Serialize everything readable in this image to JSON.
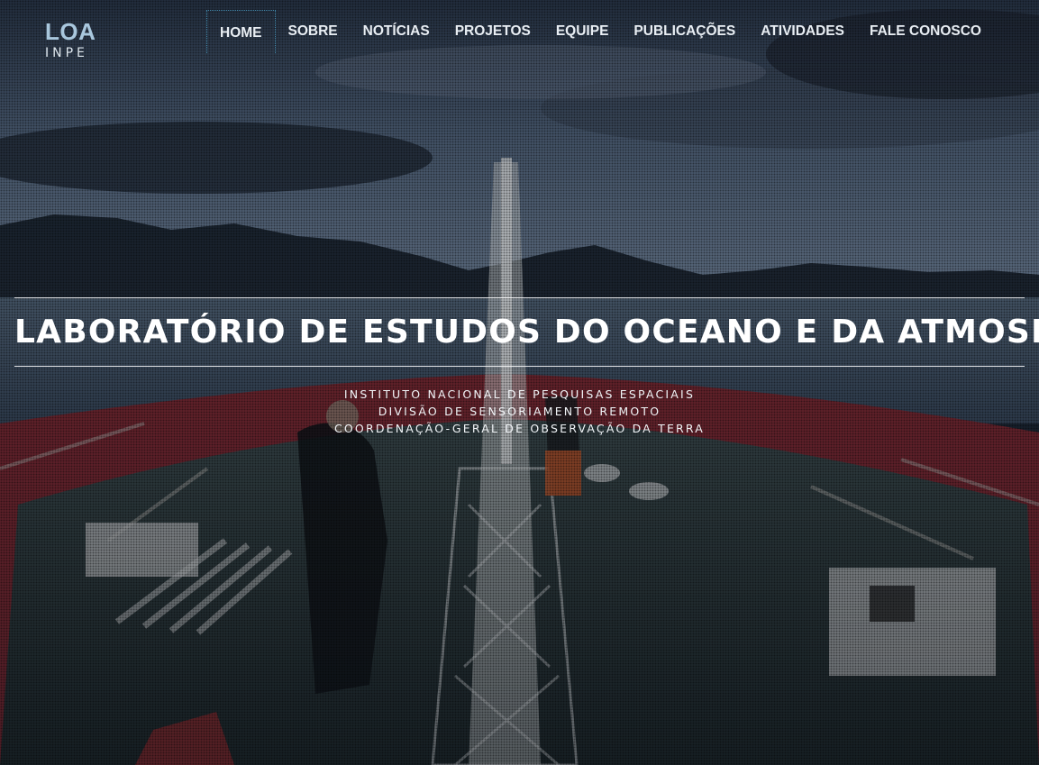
{
  "logo": {
    "main": "LOA",
    "sub": "INPE"
  },
  "nav": {
    "items": [
      {
        "label": "HOME",
        "active": true
      },
      {
        "label": "SOBRE"
      },
      {
        "label": "NOTÍCIAS"
      },
      {
        "label": "PROJETOS"
      },
      {
        "label": "EQUIPE"
      },
      {
        "label": "PUBLICAÇÕES"
      },
      {
        "label": "ATIVIDADES"
      },
      {
        "label": "FALE CONOSCO"
      }
    ]
  },
  "hero": {
    "title": "LABORATÓRIO DE ESTUDOS DO OCEANO E DA ATMOSFERA",
    "subtitles": [
      "INSTITUTO NACIONAL DE PESQUISAS ESPACIAIS",
      "DIVISÃO DE SENSORIAMENTO REMOTO",
      "COORDENAÇÃO-GERAL DE OBSERVAÇÃO DA TERRA"
    ]
  },
  "colors": {
    "logo": "#a9c7dd",
    "nav_text": "#e9eef3",
    "active_border": "#3f86a8",
    "ship_hull": "#8a2c33"
  }
}
